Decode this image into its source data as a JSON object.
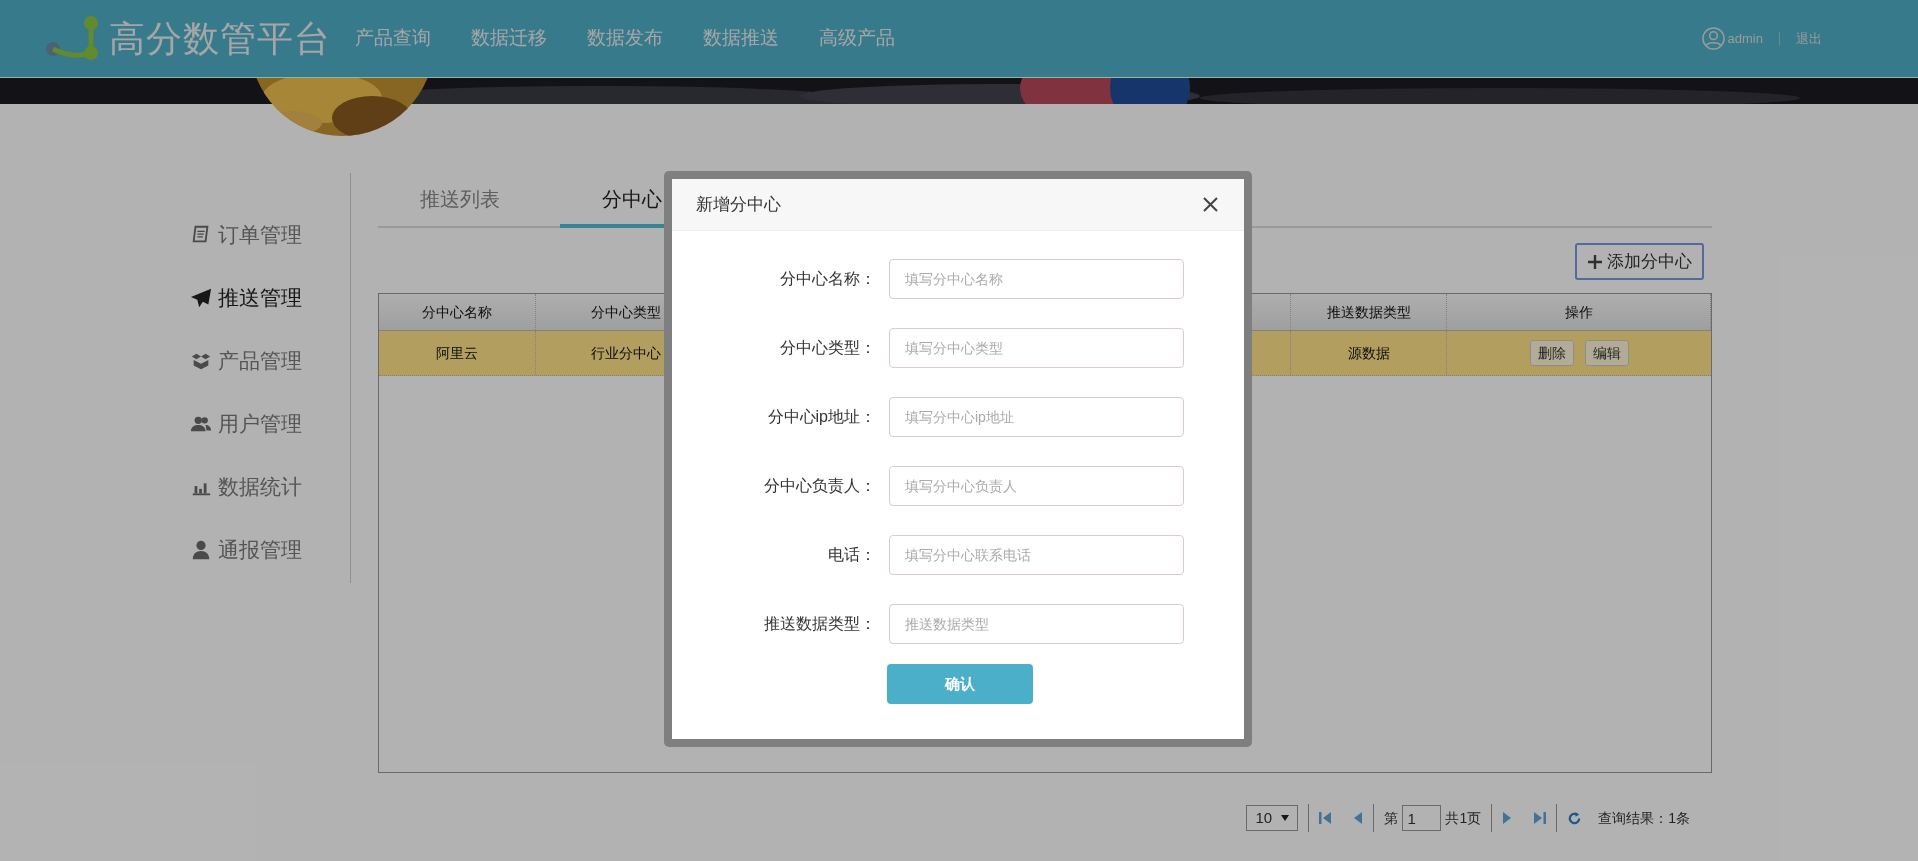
{
  "header": {
    "logo_text": "高分数管平台",
    "nav": [
      "产品查询",
      "数据迁移",
      "数据发布",
      "数据推送",
      "高级产品"
    ],
    "user": "admin",
    "logout": "退出"
  },
  "sidebar": {
    "items": [
      {
        "label": "订单管理",
        "selected": false
      },
      {
        "label": "推送管理",
        "selected": true
      },
      {
        "label": "产品管理",
        "selected": false
      },
      {
        "label": "用户管理",
        "selected": false
      },
      {
        "label": "数据统计",
        "selected": false
      },
      {
        "label": "通报管理",
        "selected": false
      }
    ]
  },
  "tabs": [
    {
      "label": "推送列表",
      "selected": false
    },
    {
      "label": "分中心",
      "selected": true
    }
  ],
  "add_button": "添加分中心",
  "table": {
    "columns": [
      "分中心名称",
      "分中心类型",
      "推送数据类型",
      "操作"
    ],
    "rows": [
      {
        "cells": [
          "阿里云",
          "行业分中心",
          "源数据"
        ],
        "actions": [
          "删除",
          "编辑"
        ],
        "selected": true
      }
    ]
  },
  "pagination": {
    "page_size": "10",
    "page_label": "第",
    "page": "1",
    "total_pages": "共1页",
    "result": "查询结果：1条"
  },
  "dialog": {
    "title": "新增分中心",
    "fields": [
      {
        "label": "分中心名称：",
        "placeholder": "填写分中心名称"
      },
      {
        "label": "分中心类型：",
        "placeholder": "填写分中心类型"
      },
      {
        "label": "分中心ip地址：",
        "placeholder": "填写分中心ip地址"
      },
      {
        "label": "分中心负责人：",
        "placeholder": "填写分中心负责人"
      },
      {
        "label": "电话：",
        "placeholder": "填写分中心联系电话"
      },
      {
        "label": "推送数据类型：",
        "placeholder": "推送数据类型"
      }
    ],
    "confirm": "确认"
  }
}
